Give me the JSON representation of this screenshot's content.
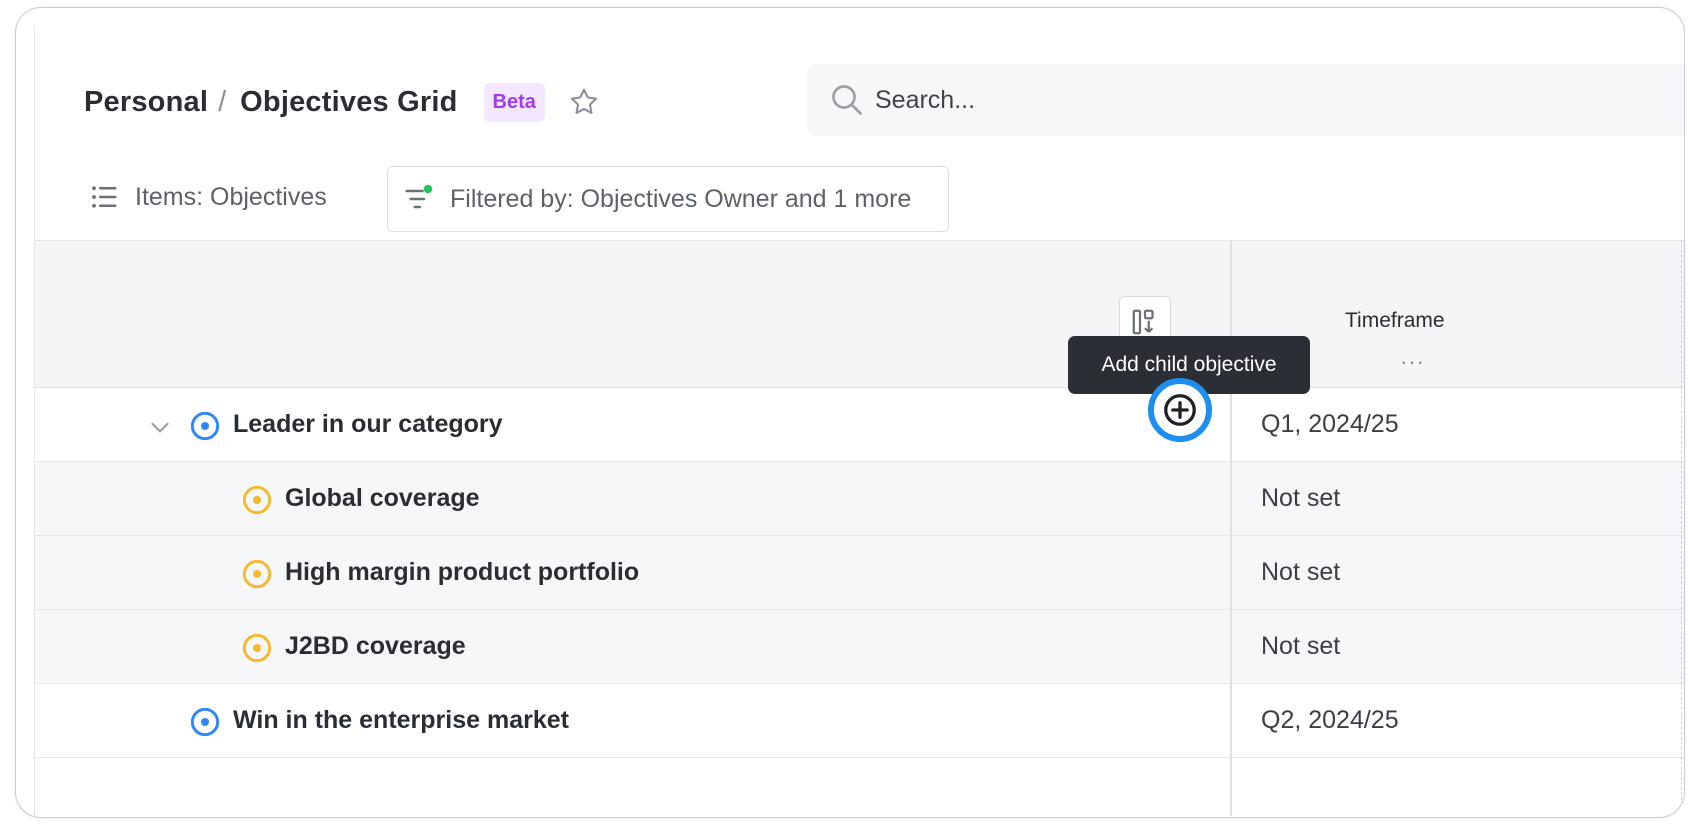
{
  "header": {
    "breadcrumb_parent": "Personal",
    "breadcrumb_separator": "/",
    "page_title": "Objectives Grid",
    "badge": "Beta",
    "favorite_icon": "star-outline-icon"
  },
  "search": {
    "placeholder": "Search...",
    "value": "",
    "icon": "search-icon"
  },
  "toolbar": {
    "items_label": "Items: Objectives",
    "filter_label": "Filtered by: Objectives Owner and 1 more"
  },
  "grid": {
    "columns": [
      {
        "label": "Timeframe",
        "menu": "···"
      }
    ],
    "tooltip": "Add child objective",
    "rows": [
      {
        "name": "Leader in our category",
        "timeframe": "Q1, 2024/25",
        "level": 0,
        "expanded": true,
        "status_color": "#2f86f6"
      },
      {
        "name": "Global coverage",
        "timeframe": "Not set",
        "level": 1,
        "status_color": "#f5b82e"
      },
      {
        "name": "High margin product portfolio",
        "timeframe": "Not set",
        "level": 1,
        "status_color": "#f5b82e"
      },
      {
        "name": "J2BD coverage",
        "timeframe": "Not set",
        "level": 1,
        "status_color": "#f5b82e"
      },
      {
        "name": "Win in the enterprise market",
        "timeframe": "Q2, 2024/25",
        "level": 0,
        "status_color": "#2f86f6"
      }
    ]
  },
  "colors": {
    "accent": "#1e8ef0",
    "beta_text": "#a23de6",
    "filter_dot": "#22c55e"
  }
}
